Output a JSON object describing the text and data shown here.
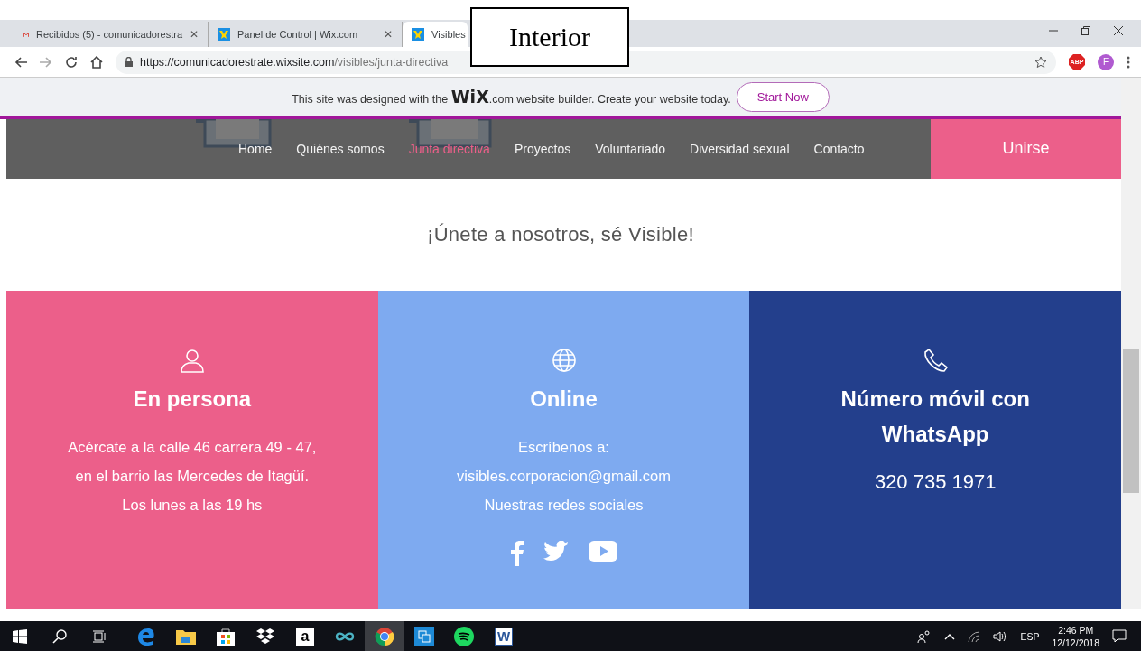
{
  "browser": {
    "tabs": [
      {
        "title": "Recibidos (5) - comunicadorestra",
        "close": "✕",
        "selected": false
      },
      {
        "title": "Panel de Control | Wix.com",
        "close": "✕",
        "selected": false
      },
      {
        "title": "Visibles",
        "selected": true
      }
    ],
    "url_host": "https://comunicadorestrate.wixsite.com",
    "url_path": "/visibles/junta-directiva",
    "extension": "ABP",
    "profile": "F"
  },
  "overlay_label": "Interior",
  "wix_banner": {
    "text": "This site was designed with the **WiX**.com website builder. Create your website today.",
    "button": "Start Now"
  },
  "nav": {
    "items": [
      {
        "label": "Home",
        "selected": false
      },
      {
        "label": "Quiénes somos",
        "selected": false
      },
      {
        "label": "Junta directiva",
        "selected": true
      },
      {
        "label": "Proyectos",
        "selected": false
      },
      {
        "label": "Voluntariado",
        "selected": false
      },
      {
        "label": "Diversidad sexual",
        "selected": false
      },
      {
        "label": "Contacto",
        "selected": false
      }
    ],
    "join_button": "Unirse"
  },
  "heading": "¡Únete a nosotros, sé Visible!",
  "cards": [
    {
      "color": "#ec5f8a",
      "title": "En persona",
      "lines": [
        "Acércate a la calle 46 carrera 49 - 47,",
        "en el barrio las Mercedes de Itagüí.",
        "Los lunes a las 19 hs"
      ],
      "social": false
    },
    {
      "color": "#7eaaf0",
      "title": "Online",
      "lines": [
        "Escríbenos a:",
        "visibles.corporacion@gmail.com",
        "Nuestras redes sociales"
      ],
      "social": true
    },
    {
      "color": "#233f8c",
      "title": "Número móvil con WhatsApp",
      "lines": [
        "320 735 1971"
      ],
      "social": false
    }
  ],
  "taskbar": {
    "apps": [
      {
        "kind": "edge",
        "selected": false
      },
      {
        "kind": "files",
        "selected": false
      },
      {
        "kind": "store",
        "selected": false
      },
      {
        "kind": "dropbox",
        "selected": false
      },
      {
        "kind": "amazon",
        "selected": false
      },
      {
        "kind": "infinity",
        "selected": false
      },
      {
        "kind": "chrome",
        "selected": true
      },
      {
        "kind": "tiles",
        "selected": false
      },
      {
        "kind": "spotify",
        "selected": false
      },
      {
        "kind": "word",
        "selected": false
      }
    ],
    "amazon_letter": "a",
    "word_letter": "W",
    "language": "ESP",
    "time": "2:46 PM",
    "date": "12/12/2018"
  }
}
